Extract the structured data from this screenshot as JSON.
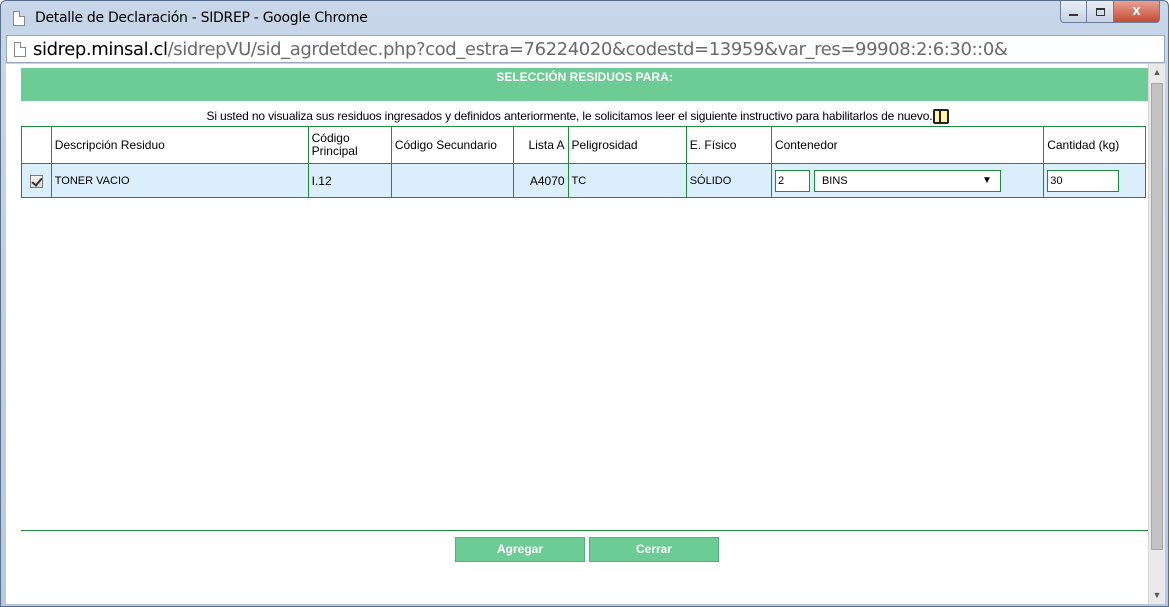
{
  "window": {
    "title": "Detalle de Declaración - SIDREP - Google Chrome",
    "controls": {
      "minimize": "",
      "maximize": "",
      "close": "X"
    }
  },
  "address_bar": {
    "host": "sidrep.minsal.cl",
    "path": "/sidrepVU/sid_agrdetdec.php?cod_estra=76224020&codestd=13959&var_res=99908:2:6:30::0&"
  },
  "page": {
    "header_title": "SELECCIÓN RESIDUOS PARA:",
    "notice": "Si usted no visualiza sus residuos ingresados y definidos anteriormente, le solicitamos leer el siguiente instructivo para habilitarlos de nuevo.",
    "notice_icon": "book-icon",
    "table": {
      "headers": {
        "descripcion": "Descripción Residuo",
        "codigo_principal": "Código Principal",
        "codigo_secundario": "Código Secundario",
        "lista_a": "Lista A",
        "peligrosidad": "Peligrosidad",
        "estado_fisico": "E. Físico",
        "contenedor": "Contenedor",
        "cantidad": "Cantidad (kg)"
      },
      "rows": [
        {
          "checked": true,
          "descripcion": "TONER VACIO",
          "codigo_principal": "I.12",
          "codigo_secundario": "",
          "lista_a": "A4070",
          "peligrosidad": "TC",
          "estado_fisico": "SÓLIDO",
          "contenedor_cantidad": "2",
          "contenedor_tipo": "BINS",
          "cantidad_kg": "30"
        }
      ]
    },
    "buttons": {
      "agregar": "Agregar",
      "cerrar": "Cerrar"
    }
  },
  "colors": {
    "accent_green": "#6dcb95",
    "border_green": "#1f8c3c",
    "row_background": "#dbeefb",
    "close_button": "#c44c33"
  }
}
